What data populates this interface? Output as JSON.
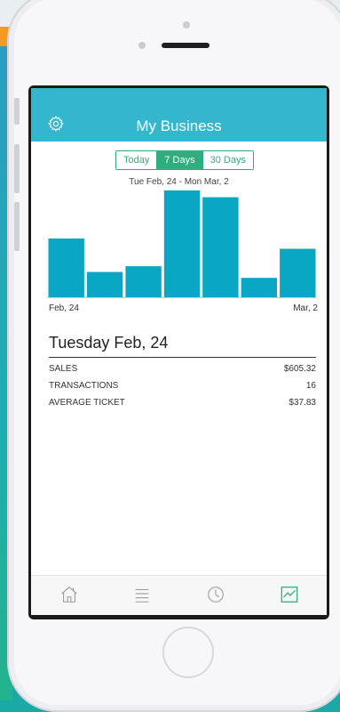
{
  "app": {
    "title": "My Business"
  },
  "segments": [
    {
      "label": "Today",
      "active": false
    },
    {
      "label": "7 Days",
      "active": true
    },
    {
      "label": "30 Days",
      "active": false
    }
  ],
  "date_range": "Tue Feb, 24 - Mon Mar, 2",
  "chart_data": {
    "type": "bar",
    "categories": [
      "Feb, 24",
      "",
      "",
      "",
      "",
      "",
      "Mar, 2"
    ],
    "values": [
      605.32,
      260,
      320,
      1100,
      1030,
      200,
      500
    ],
    "x_start_label": "Feb, 24",
    "x_end_label": "Mar, 2",
    "color": "#0aa7c5",
    "ylim": [
      0,
      1100
    ]
  },
  "detail": {
    "day_title": "Tuesday Feb, 24",
    "stats": [
      {
        "label": "SALES",
        "value": "$605.32"
      },
      {
        "label": "TRANSACTIONS",
        "value": "16"
      },
      {
        "label": "AVERAGE TICKET",
        "value": "$37.83"
      }
    ]
  },
  "tabs": [
    {
      "icon": "home-icon",
      "active": false
    },
    {
      "icon": "list-icon",
      "active": false
    },
    {
      "icon": "clock-icon",
      "active": false
    },
    {
      "icon": "chart-icon",
      "active": true
    }
  ],
  "colors": {
    "header": "#35b6cf",
    "accent_green": "#2fae7d",
    "bar": "#0aa7c5"
  }
}
